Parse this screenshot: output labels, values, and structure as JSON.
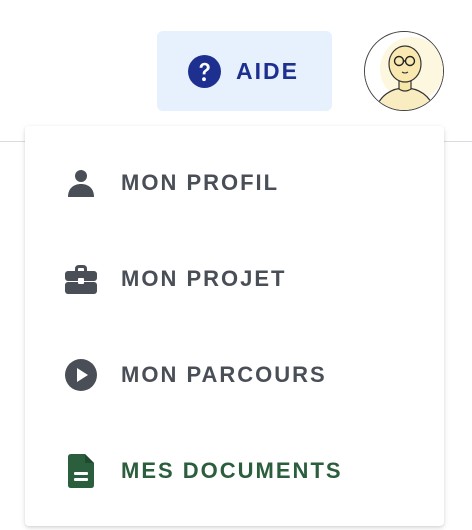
{
  "header": {
    "help_label": "AIDE",
    "avatar_alt": "avatar"
  },
  "menu": {
    "items": [
      {
        "label": "MON PROFIL",
        "icon": "person-icon"
      },
      {
        "label": "MON PROJET",
        "icon": "briefcase-icon"
      },
      {
        "label": "MON PARCOURS",
        "icon": "play-circle-icon"
      },
      {
        "label": "MES DOCUMENTS",
        "icon": "document-icon",
        "active": true
      }
    ]
  },
  "colors": {
    "help_bg": "#e7f0fd",
    "help_text": "#1d2f8f",
    "menu_text": "#4a4f57",
    "active_text": "#2b5e3c"
  }
}
